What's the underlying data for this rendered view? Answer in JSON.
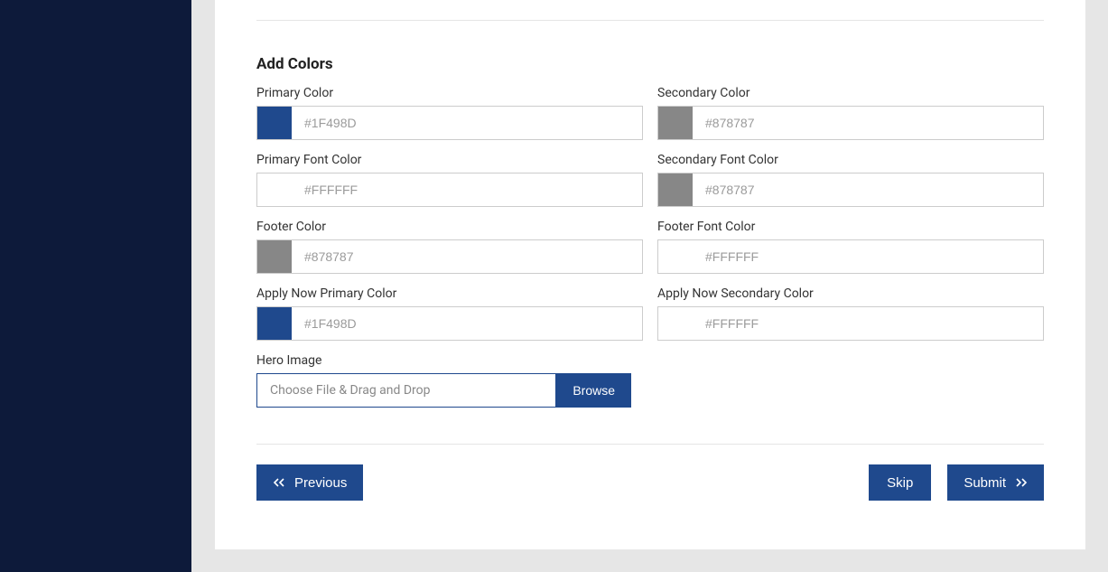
{
  "section": {
    "title": "Add Colors"
  },
  "fields": {
    "primary": {
      "label": "Primary Color",
      "value": "#1F498D",
      "swatch": "#1f498d"
    },
    "secondary": {
      "label": "Secondary Color",
      "value": "#878787",
      "swatch": "#878787"
    },
    "primaryFont": {
      "label": "Primary Font Color",
      "value": "#FFFFFF",
      "swatch": "#ffffff"
    },
    "secondaryFont": {
      "label": "Secondary Font Color",
      "value": "#878787",
      "swatch": "#878787"
    },
    "footer": {
      "label": "Footer Color",
      "value": "#878787",
      "swatch": "#878787"
    },
    "footerFont": {
      "label": "Footer Font Color",
      "value": "#FFFFFF",
      "swatch": "#ffffff"
    },
    "applyPrimary": {
      "label": "Apply Now Primary Color",
      "value": "#1F498D",
      "swatch": "#1f498d"
    },
    "applySecondary": {
      "label": "Apply Now Secondary Color",
      "value": "#FFFFFF",
      "swatch": "#ffffff"
    }
  },
  "heroImage": {
    "label": "Hero Image",
    "placeholder": "Choose File & Drag and Drop",
    "browse": "Browse"
  },
  "buttons": {
    "previous": "Previous",
    "skip": "Skip",
    "submit": "Submit"
  }
}
